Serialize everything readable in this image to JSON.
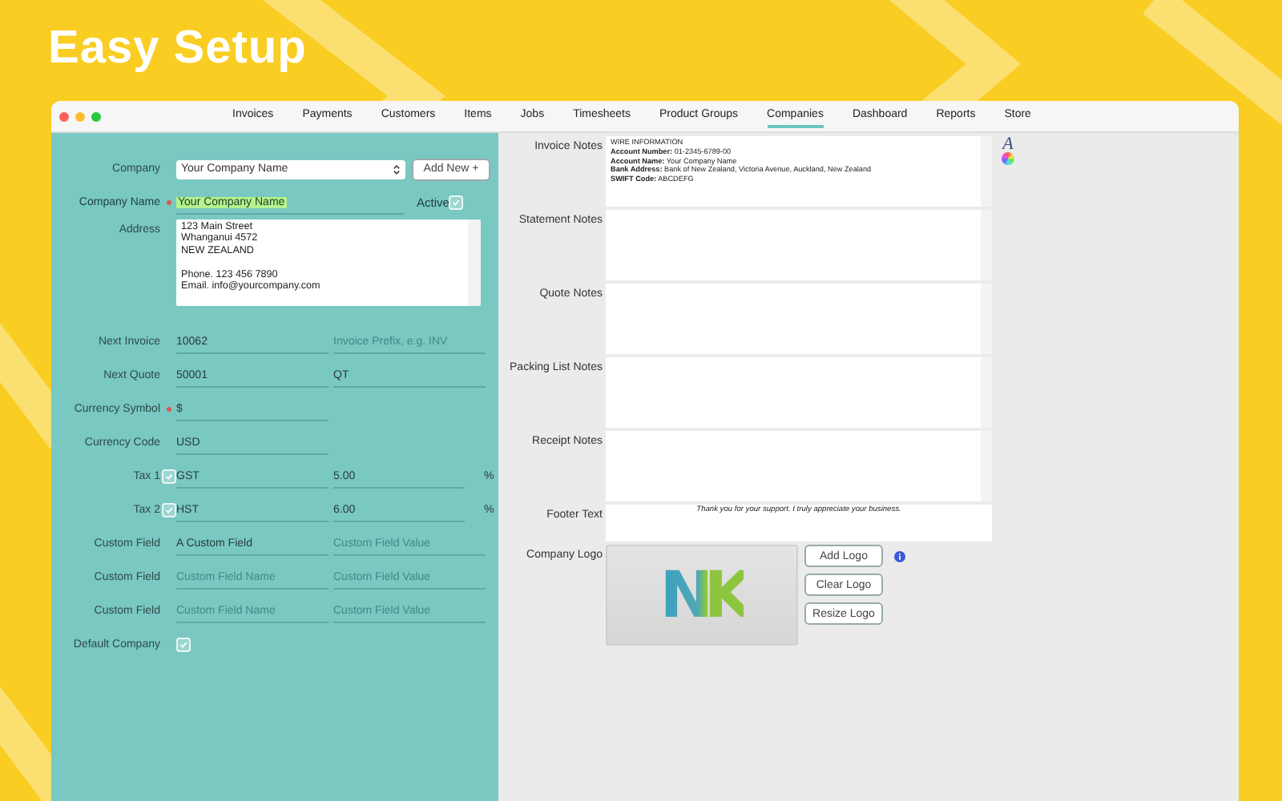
{
  "headline": "Easy Setup",
  "window": {
    "tabs": [
      {
        "label": "Invoices",
        "selected": false
      },
      {
        "label": "Payments",
        "selected": false
      },
      {
        "label": "Customers",
        "selected": false
      },
      {
        "label": "Items",
        "selected": false
      },
      {
        "label": "Jobs",
        "selected": false
      },
      {
        "label": "Timesheets",
        "selected": false
      },
      {
        "label": "Product Groups",
        "selected": false
      },
      {
        "label": "Companies",
        "selected": true
      },
      {
        "label": "Dashboard",
        "selected": false
      },
      {
        "label": "Reports",
        "selected": false
      },
      {
        "label": "Store",
        "selected": false
      }
    ]
  },
  "form": [
    {
      "kind": "select",
      "label": "Company",
      "value": "Your Company Name",
      "button": "Add New +"
    },
    {
      "kind": "name",
      "label": "Company Name",
      "required": true,
      "value": "Your Company Name",
      "active_label": "Active",
      "active_checked": true
    },
    {
      "kind": "textarea",
      "label": "Address",
      "blocks": [
        [
          "123 Main Street",
          "Whanganui 4572",
          "NEW ZEALAND"
        ],
        [
          "Phone. 123 456 7890",
          "Email. info@yourcompany.com"
        ]
      ]
    },
    {
      "kind": "pair",
      "label": "Next Invoice",
      "field1": {
        "value": "10062"
      },
      "field2": {
        "placeholder": "Invoice Prefix, e.g. INV"
      }
    },
    {
      "kind": "pair",
      "label": "Next Quote",
      "field1": {
        "value": "50001"
      },
      "field2": {
        "value": "QT"
      }
    },
    {
      "kind": "pair",
      "label": "Currency Symbol",
      "required": true,
      "field1": {
        "value": "$"
      }
    },
    {
      "kind": "pair",
      "label": "Currency Code",
      "field1": {
        "value": "USD"
      }
    },
    {
      "kind": "pair",
      "label": "Tax 1",
      "checked": true,
      "field1": {
        "value": "GST"
      },
      "field2": {
        "value": "5.00"
      },
      "suffix": "%"
    },
    {
      "kind": "pair",
      "label": "Tax 2",
      "checked": true,
      "field1": {
        "value": "HST"
      },
      "field2": {
        "value": "6.00"
      },
      "suffix": "%"
    },
    {
      "kind": "pair",
      "label": "Custom Field",
      "field1": {
        "value": "A Custom Field"
      },
      "field2": {
        "placeholder": "Custom Field Value"
      }
    },
    {
      "kind": "pair",
      "label": "Custom Field",
      "field1": {
        "placeholder": "Custom Field Name"
      },
      "field2": {
        "placeholder": "Custom Field Value"
      }
    },
    {
      "kind": "pair",
      "label": "Custom Field",
      "field1": {
        "placeholder": "Custom Field Name"
      },
      "field2": {
        "placeholder": "Custom Field Value"
      }
    },
    {
      "kind": "check",
      "label": "Default Company",
      "checked": true
    }
  ],
  "notes": [
    {
      "label": "Invoice Notes",
      "lines": [
        "WIRE INFORMATION",
        "**Account Number:** 01-2345-6789-00",
        "**Account Name:** Your Company Name",
        "**Bank Address:** Bank of New Zealand, Victoria Avenue, Auckland, New Zealand",
        "**SWIFT Code:** ABCDEFG"
      ]
    },
    {
      "label": "Statement Notes"
    },
    {
      "label": "Quote Notes"
    },
    {
      "label": "Packing List Notes"
    },
    {
      "label": "Receipt Notes"
    }
  ],
  "font_button": "A",
  "footer": {
    "label": "Footer Text",
    "value": "Thank you for your support. I truly appreciate your business."
  },
  "logo": {
    "label": "Company Logo",
    "logo_text": "NK",
    "buttons": [
      "Add Logo",
      "Clear Logo",
      "Resize Logo"
    ]
  }
}
